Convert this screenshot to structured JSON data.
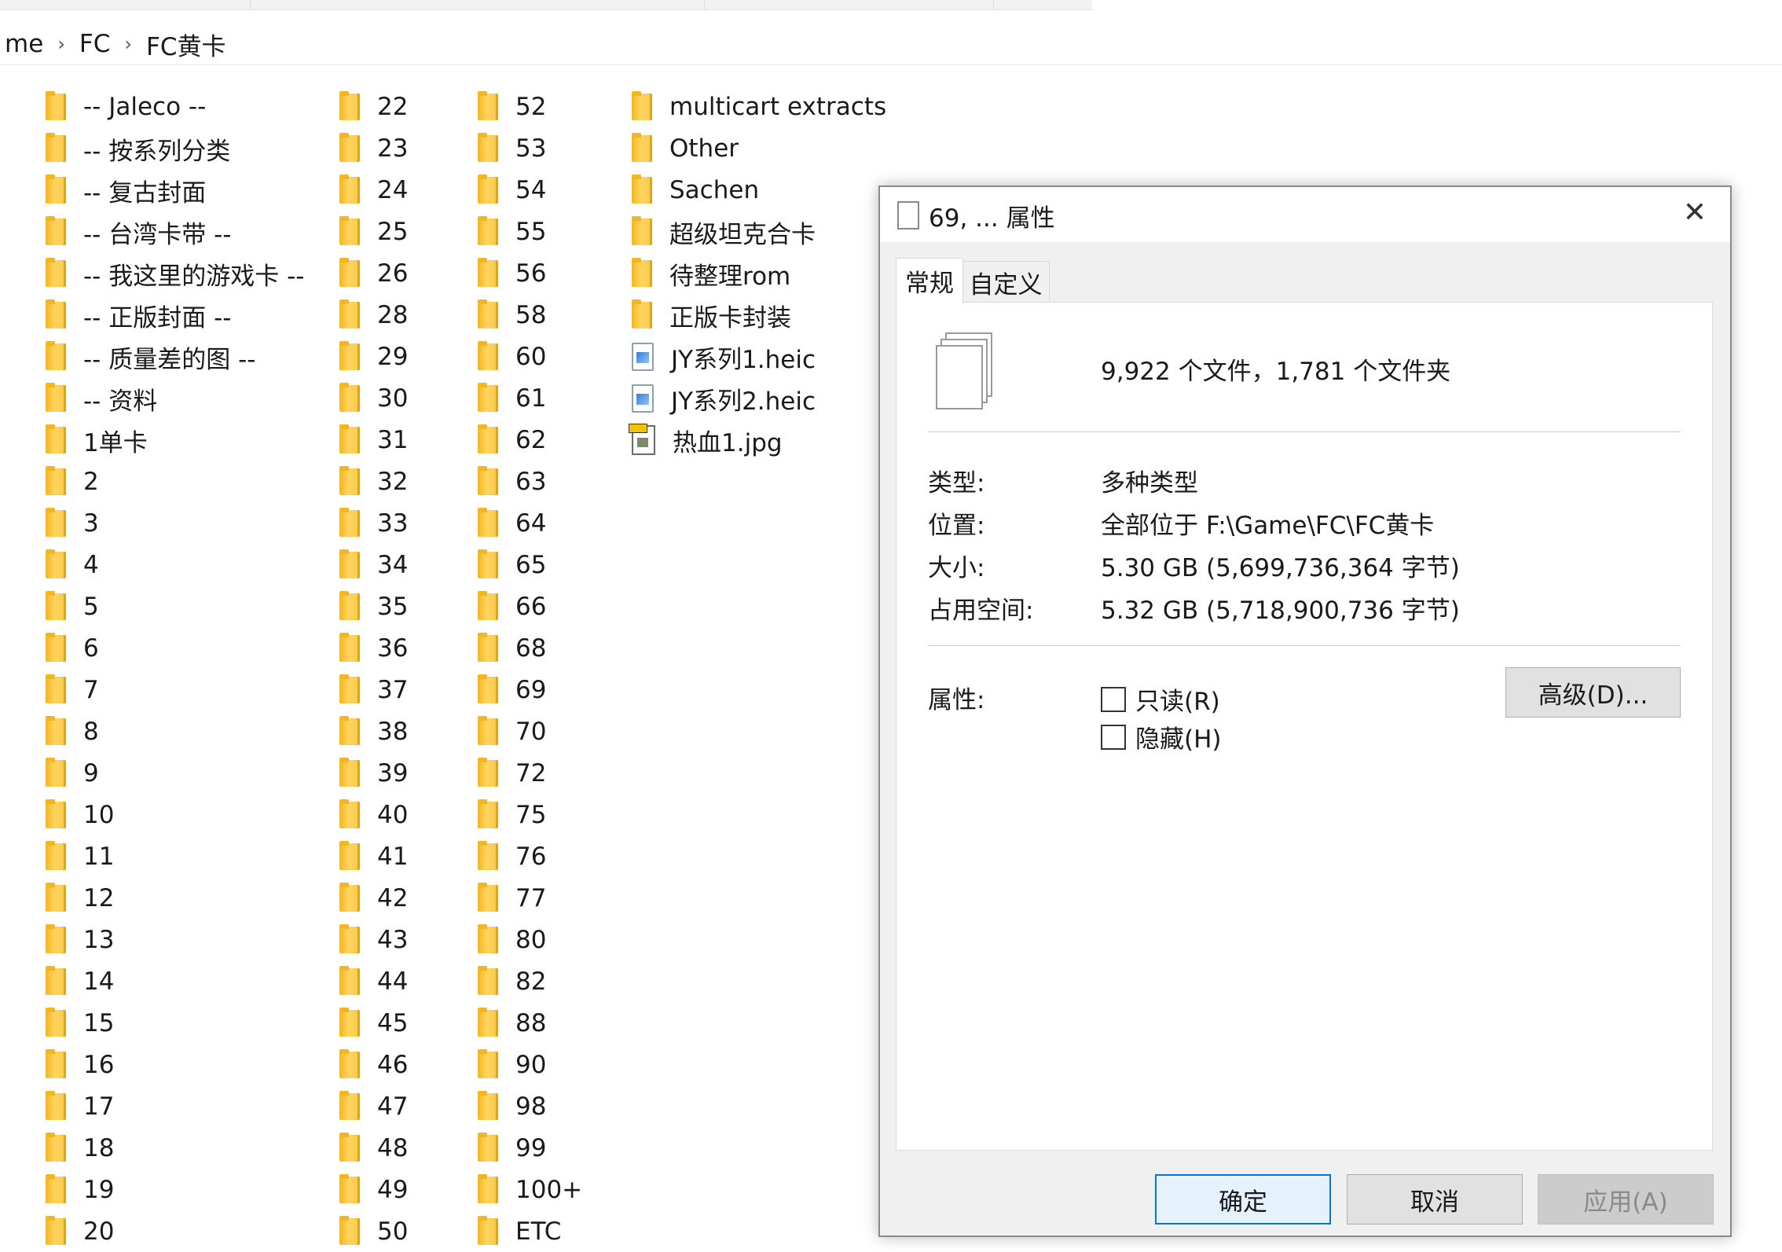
{
  "breadcrumb": [
    "me",
    "FC",
    "FC黄卡"
  ],
  "columns": [
    [
      {
        "name": "-- Jaleco --",
        "type": "folder"
      },
      {
        "name": "-- 按系列分类",
        "type": "folder"
      },
      {
        "name": "-- 复古封面",
        "type": "folder"
      },
      {
        "name": "-- 台湾卡带 --",
        "type": "folder"
      },
      {
        "name": "-- 我这里的游戏卡 --",
        "type": "folder"
      },
      {
        "name": "-- 正版封面 --",
        "type": "folder"
      },
      {
        "name": "-- 质量差的图 --",
        "type": "folder"
      },
      {
        "name": "-- 资料",
        "type": "folder"
      },
      {
        "name": "1单卡",
        "type": "folder"
      },
      {
        "name": "2",
        "type": "folder"
      },
      {
        "name": "3",
        "type": "folder"
      },
      {
        "name": "4",
        "type": "folder"
      },
      {
        "name": "5",
        "type": "folder"
      },
      {
        "name": "6",
        "type": "folder"
      },
      {
        "name": "7",
        "type": "folder"
      },
      {
        "name": "8",
        "type": "folder"
      },
      {
        "name": "9",
        "type": "folder"
      },
      {
        "name": "10",
        "type": "folder"
      },
      {
        "name": "11",
        "type": "folder"
      },
      {
        "name": "12",
        "type": "folder"
      },
      {
        "name": "13",
        "type": "folder"
      },
      {
        "name": "14",
        "type": "folder"
      },
      {
        "name": "15",
        "type": "folder"
      },
      {
        "name": "16",
        "type": "folder"
      },
      {
        "name": "17",
        "type": "folder"
      },
      {
        "name": "18",
        "type": "folder"
      },
      {
        "name": "19",
        "type": "folder"
      },
      {
        "name": "20",
        "type": "folder"
      }
    ],
    [
      {
        "name": "22",
        "type": "folder"
      },
      {
        "name": "23",
        "type": "folder"
      },
      {
        "name": "24",
        "type": "folder"
      },
      {
        "name": "25",
        "type": "folder"
      },
      {
        "name": "26",
        "type": "folder"
      },
      {
        "name": "28",
        "type": "folder"
      },
      {
        "name": "29",
        "type": "folder"
      },
      {
        "name": "30",
        "type": "folder"
      },
      {
        "name": "31",
        "type": "folder"
      },
      {
        "name": "32",
        "type": "folder"
      },
      {
        "name": "33",
        "type": "folder"
      },
      {
        "name": "34",
        "type": "folder"
      },
      {
        "name": "35",
        "type": "folder"
      },
      {
        "name": "36",
        "type": "folder"
      },
      {
        "name": "37",
        "type": "folder"
      },
      {
        "name": "38",
        "type": "folder"
      },
      {
        "name": "39",
        "type": "folder"
      },
      {
        "name": "40",
        "type": "folder"
      },
      {
        "name": "41",
        "type": "folder"
      },
      {
        "name": "42",
        "type": "folder"
      },
      {
        "name": "43",
        "type": "folder"
      },
      {
        "name": "44",
        "type": "folder"
      },
      {
        "name": "45",
        "type": "folder"
      },
      {
        "name": "46",
        "type": "folder"
      },
      {
        "name": "47",
        "type": "folder"
      },
      {
        "name": "48",
        "type": "folder"
      },
      {
        "name": "49",
        "type": "folder"
      },
      {
        "name": "50",
        "type": "folder"
      }
    ],
    [
      {
        "name": "52",
        "type": "folder"
      },
      {
        "name": "53",
        "type": "folder"
      },
      {
        "name": "54",
        "type": "folder"
      },
      {
        "name": "55",
        "type": "folder"
      },
      {
        "name": "56",
        "type": "folder"
      },
      {
        "name": "58",
        "type": "folder"
      },
      {
        "name": "60",
        "type": "folder"
      },
      {
        "name": "61",
        "type": "folder"
      },
      {
        "name": "62",
        "type": "folder"
      },
      {
        "name": "63",
        "type": "folder"
      },
      {
        "name": "64",
        "type": "folder"
      },
      {
        "name": "65",
        "type": "folder"
      },
      {
        "name": "66",
        "type": "folder"
      },
      {
        "name": "68",
        "type": "folder"
      },
      {
        "name": "69",
        "type": "folder"
      },
      {
        "name": "70",
        "type": "folder"
      },
      {
        "name": "72",
        "type": "folder"
      },
      {
        "name": "75",
        "type": "folder"
      },
      {
        "name": "76",
        "type": "folder"
      },
      {
        "name": "77",
        "type": "folder"
      },
      {
        "name": "80",
        "type": "folder"
      },
      {
        "name": "82",
        "type": "folder"
      },
      {
        "name": "88",
        "type": "folder"
      },
      {
        "name": "90",
        "type": "folder"
      },
      {
        "name": "98",
        "type": "folder"
      },
      {
        "name": "99",
        "type": "folder"
      },
      {
        "name": "100+",
        "type": "folder"
      },
      {
        "name": "ETC",
        "type": "folder"
      }
    ],
    [
      {
        "name": "multicart extracts",
        "type": "folder"
      },
      {
        "name": "Other",
        "type": "folder"
      },
      {
        "name": "Sachen",
        "type": "folder"
      },
      {
        "name": "超级坦克合卡",
        "type": "folder"
      },
      {
        "name": "待整理rom",
        "type": "folder"
      },
      {
        "name": "正版卡封装",
        "type": "folder"
      },
      {
        "name": "JY系列1.heic",
        "type": "heic"
      },
      {
        "name": "JY系列2.heic",
        "type": "heic"
      },
      {
        "name": "热血1.jpg",
        "type": "jpg"
      }
    ]
  ],
  "dialog": {
    "title": "69, ... 属性",
    "close_glyph": "✕",
    "tabs": [
      "常规",
      "自定义"
    ],
    "summary": "9,922 个文件，1,781 个文件夹",
    "type_label": "类型:",
    "type_value": "多种类型",
    "location_label": "位置:",
    "location_value": "全部位于 F:\\Game\\FC\\FC黄卡",
    "size_label": "大小:",
    "size_value": "5.30 GB (5,699,736,364 字节)",
    "disk_label": "占用空间:",
    "disk_value": "5.32 GB (5,718,900,736 字节)",
    "attr_label": "属性:",
    "readonly_label": "只读(R)",
    "hidden_label": "隐藏(H)",
    "advanced_label": "高级(D)...",
    "ok_label": "确定",
    "cancel_label": "取消",
    "apply_label": "应用(A)"
  },
  "colors": {
    "folder": "#f9c94a",
    "primary_border": "#0078d7"
  }
}
